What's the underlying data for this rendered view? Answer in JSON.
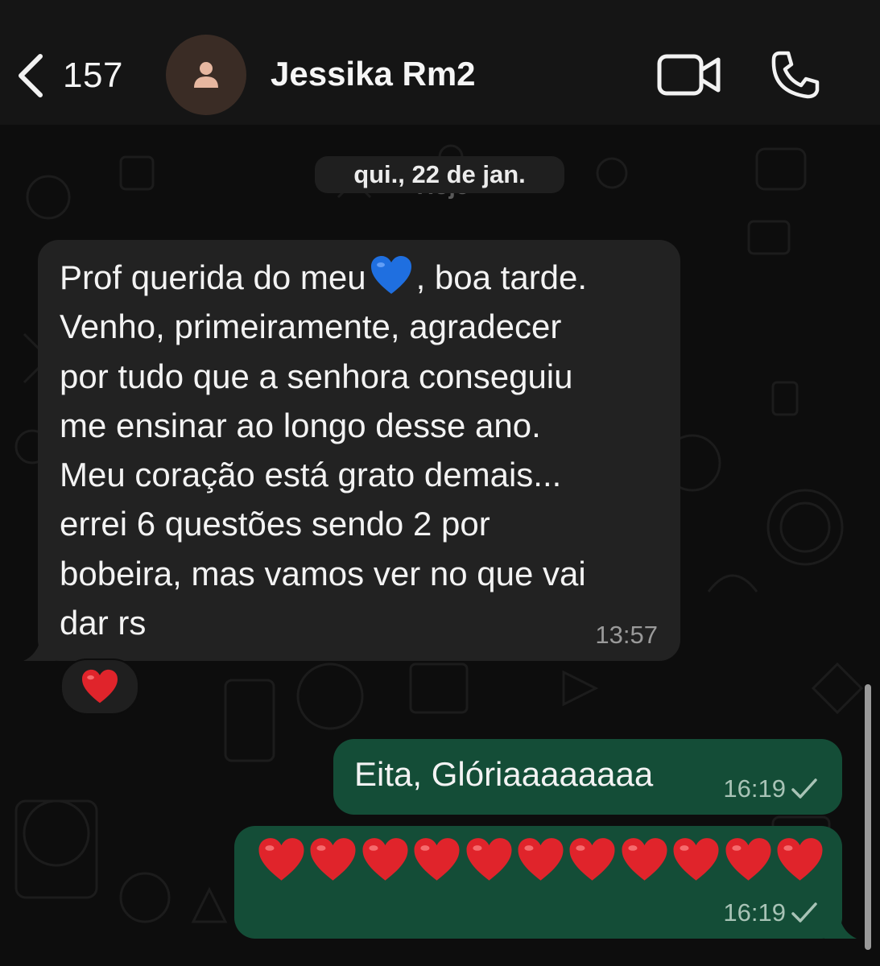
{
  "header": {
    "back_count": "157",
    "contact_name": "Jessika Rm2",
    "back_icon": "chevron-left-icon",
    "avatar_icon": "person-icon",
    "video_icon": "video-camera-icon",
    "call_icon": "phone-icon"
  },
  "chat": {
    "date_label": "qui., 22 de jan.",
    "date_ghost_label": "Hoje",
    "messages": [
      {
        "direction": "incoming",
        "lines": [
          "Prof querida do meu",
          ", boa tarde.",
          "Venho, primeiramente, agradecer",
          "por tudo que a senhora conseguiu",
          "me ensinar ao longo desse ano.",
          "Meu coração está grato demais...",
          "errei 6 questões sendo 2 por",
          "bobeira, mas vamos ver no que vai",
          "dar rs"
        ],
        "inline_emoji": "blue-heart-icon",
        "time": "13:57",
        "reaction": "red-heart-icon"
      },
      {
        "direction": "outgoing",
        "text": "Eita, Glóriaaaaaaaa",
        "time": "16:19",
        "status_icon": "check-icon"
      },
      {
        "direction": "outgoing",
        "emoji": "red-heart-icon",
        "emoji_count": 11,
        "time": "16:19",
        "status_icon": "check-icon"
      }
    ]
  },
  "colors": {
    "header_bg": "#151515",
    "chat_bg": "#0d0d0d",
    "incoming_bubble": "#222222",
    "outgoing_bubble": "#144d37",
    "heart_red": "#e0242b",
    "heart_blue": "#1f6fe0"
  }
}
